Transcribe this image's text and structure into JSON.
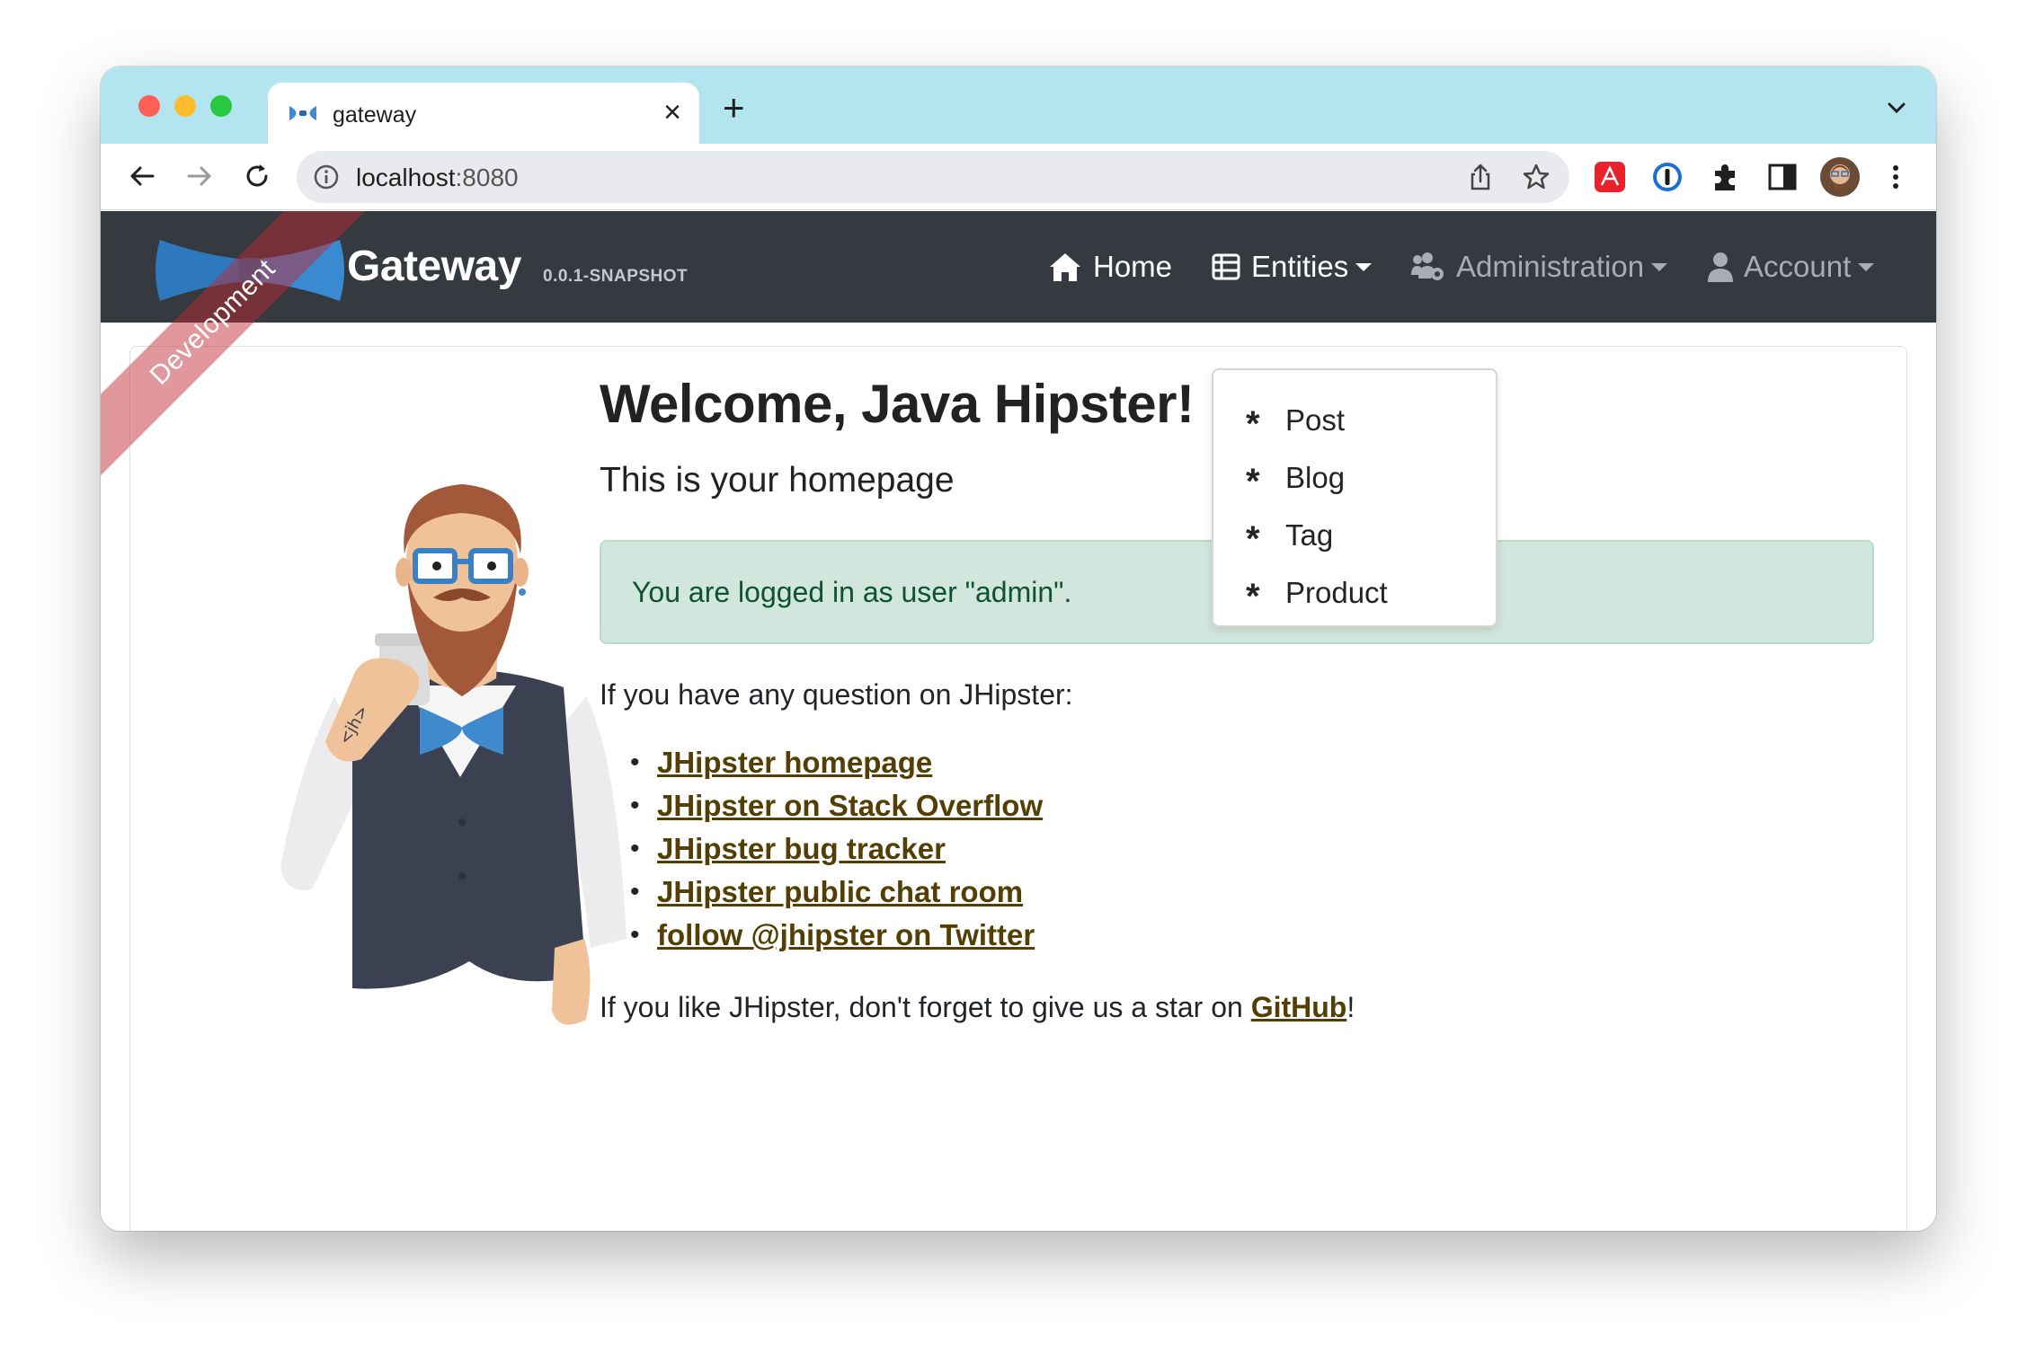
{
  "browser": {
    "tab_title": "gateway",
    "url_host": "localhost",
    "url_port": ":8080"
  },
  "navbar": {
    "brand": "Gateway",
    "version": "0.0.1-SNAPSHOT",
    "ribbon": "Development",
    "items": [
      {
        "label": "Home",
        "icon": "home-icon"
      },
      {
        "label": "Entities",
        "icon": "table-list-icon"
      },
      {
        "label": "Administration",
        "icon": "users-cog-icon"
      },
      {
        "label": "Account",
        "icon": "user-icon"
      }
    ]
  },
  "entities_menu": [
    "Post",
    "Blog",
    "Tag",
    "Product"
  ],
  "main": {
    "title": "Welcome, Java Hipster!",
    "subtitle": "This is your homepage",
    "alert": "You are logged in as user \"admin\".",
    "question": "If you have any question on JHipster:",
    "links": [
      "JHipster homepage",
      "JHipster on Stack Overflow",
      "JHipster bug tracker",
      "JHipster public chat room",
      "follow @jhipster on Twitter"
    ],
    "star_prefix": "If you like JHipster, don't forget to give us a star on ",
    "star_link": "GitHub",
    "star_suffix": "!"
  },
  "colors": {
    "navbar_bg": "#343a40",
    "tabstrip_bg": "#b3e5f0",
    "alert_bg": "#d1e7dd",
    "alert_text": "#0f5132",
    "link": "#533f03",
    "ribbon": "#c02832"
  }
}
